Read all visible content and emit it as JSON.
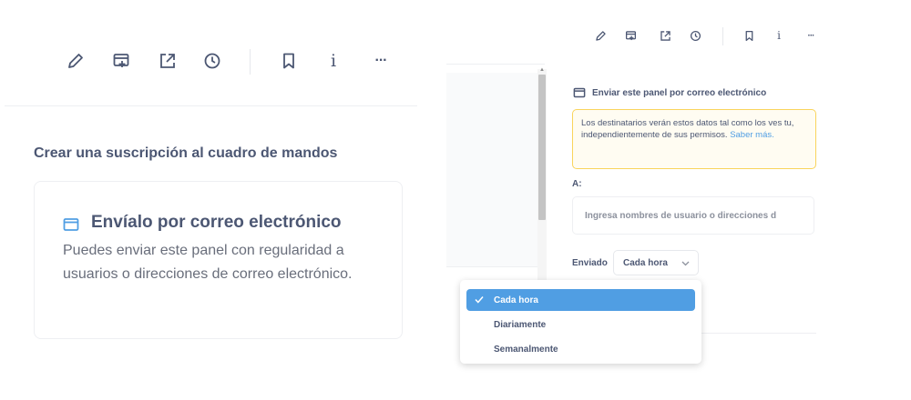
{
  "left": {
    "title": "Crear una suscripción al cuadro de mandos",
    "card": {
      "heading": "Envíalo por correo electrónico",
      "description": "Puedes enviar este panel con regularidad a usuarios o direcciones de correo electrónico."
    }
  },
  "toolbar": {
    "icons": [
      "pencil-icon",
      "add-to-panel-icon",
      "share-icon",
      "clock-icon",
      "bookmark-icon",
      "info-icon",
      "more-icon"
    ],
    "info_glyph": "i",
    "more_glyph": "···"
  },
  "right": {
    "send_title": "Enviar este panel por correo electrónico",
    "warning_text": "Los destinatarios verán estos datos tal como los ves tu, independientemente de sus permisos.",
    "warning_link": "Saber más.",
    "to_label": "A:",
    "recipient_placeholder": "Ingresa nombres de usuario o direcciones d",
    "sent_label": "Enviado",
    "frequency_value": "Cada hora",
    "frequency_options": [
      "Cada hora",
      "Diariamente",
      "Semanalmente"
    ],
    "frequency_selected": "Cada hora"
  },
  "colors": {
    "accent": "#509ee3",
    "text": "#4c5773",
    "warning_border": "#f9d45c",
    "warning_bg": "#fffcf2"
  }
}
